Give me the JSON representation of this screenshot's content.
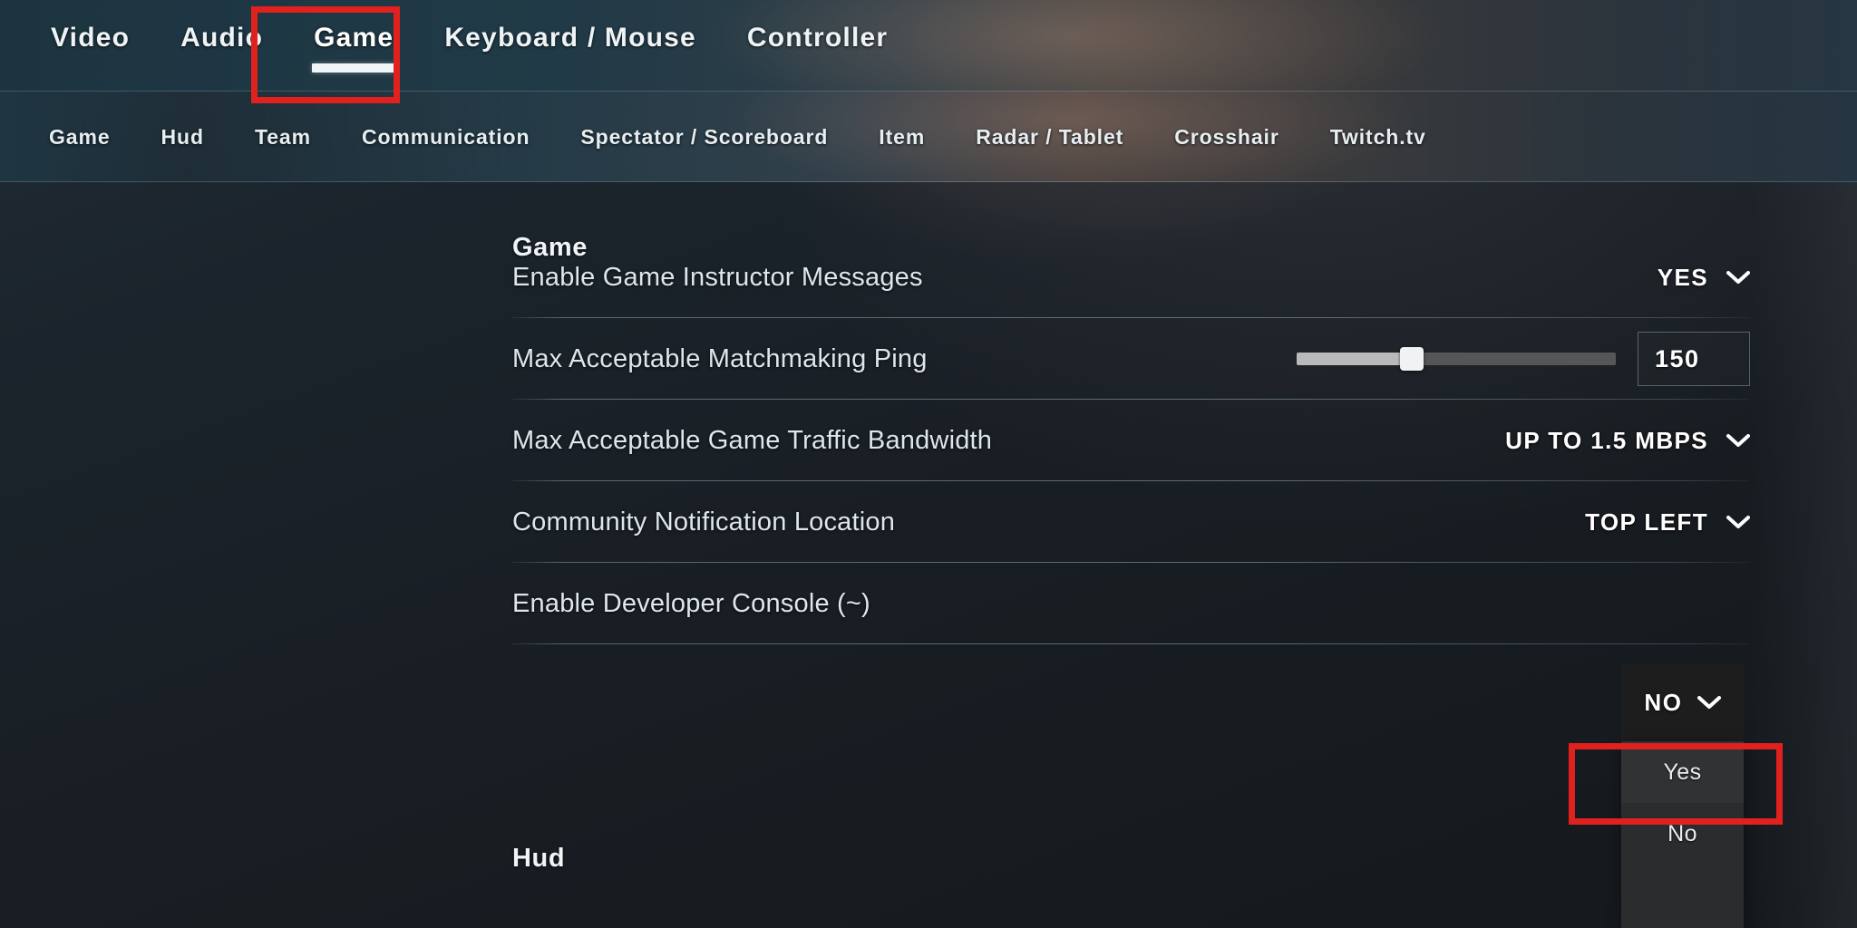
{
  "accent": {
    "annotation_red": "#e0211d",
    "text_primary": "#ffffff",
    "text_secondary": "#dfe6ea",
    "nav_bg": "#23363f"
  },
  "topnav": {
    "items": [
      {
        "label": "Video",
        "active": false
      },
      {
        "label": "Audio",
        "active": false
      },
      {
        "label": "Game",
        "active": true
      },
      {
        "label": "Keyboard / Mouse",
        "active": false
      },
      {
        "label": "Controller",
        "active": false
      }
    ]
  },
  "subnav": {
    "items": [
      {
        "label": "Game"
      },
      {
        "label": "Hud"
      },
      {
        "label": "Team"
      },
      {
        "label": "Communication"
      },
      {
        "label": "Spectator / Scoreboard"
      },
      {
        "label": "Item"
      },
      {
        "label": "Radar / Tablet"
      },
      {
        "label": "Crosshair"
      },
      {
        "label": "Twitch.tv"
      }
    ]
  },
  "content": {
    "section_game_title": "Game",
    "section_hud_title": "Hud",
    "settings": [
      {
        "label": "Enable Game Instructor Messages",
        "type": "dropdown",
        "value": "YES",
        "icon": "chevron-down-icon"
      },
      {
        "label": "Max Acceptable Matchmaking Ping",
        "type": "slider",
        "value": "150",
        "slider_percent": 36
      },
      {
        "label": "Max Acceptable Game Traffic Bandwidth",
        "type": "dropdown",
        "value": "UP TO 1.5 MBPS",
        "icon": "chevron-down-icon"
      },
      {
        "label": "Community Notification Location",
        "type": "dropdown",
        "value": "TOP LEFT",
        "icon": "chevron-down-icon"
      },
      {
        "label": "Enable Developer Console (~)",
        "type": "dropdown-open",
        "value": "NO",
        "icon": "chevron-down-icon",
        "options": [
          {
            "label": "Yes",
            "highlighted": true
          },
          {
            "label": "No",
            "highlighted": false
          }
        ]
      }
    ]
  },
  "annotations": [
    {
      "name": "game-tab-highlight",
      "target": "Game"
    },
    {
      "name": "yes-option-highlight",
      "target": "Yes"
    }
  ]
}
